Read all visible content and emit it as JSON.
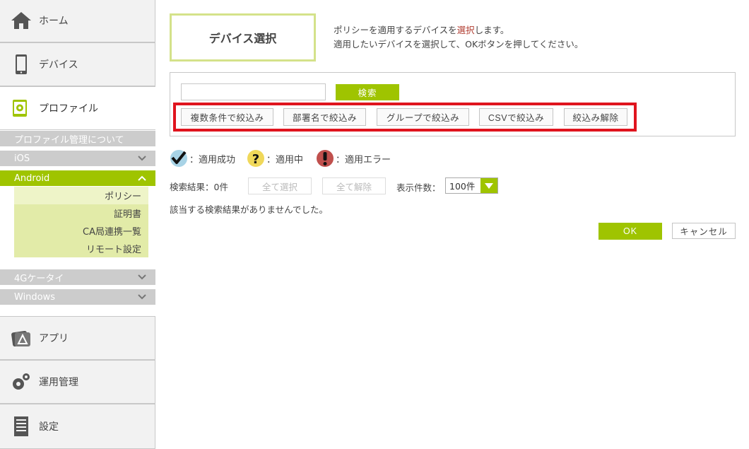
{
  "sidebar": {
    "home": "ホーム",
    "devices": "デバイス",
    "profiles": "プロファイル",
    "profile_about": "プロファイル管理について",
    "ios": "iOS",
    "android": "Android",
    "android_items": [
      "ポリシー",
      "証明書",
      "CA局連携一覧",
      "リモート設定"
    ],
    "g4": "4Gケータイ",
    "windows": "Windows",
    "apps": "アプリ",
    "operations": "運用管理",
    "settings": "設定"
  },
  "main": {
    "title": "デバイス選択",
    "desc_line1_pre": "ポリシーを適用するデバイスを",
    "desc_line1_hl": "選択",
    "desc_line1_post": "します。",
    "desc_line2": "適用したいデバイスを選択して、OKボタンを押してください。",
    "search_value": "",
    "search_button": "検索",
    "filters": [
      "複数条件で絞込み",
      "部署名で絞込み",
      "グループで絞込み",
      "CSVで絞込み",
      "絞込み解除"
    ],
    "legend": [
      {
        "label": "：適用成功",
        "color": "#a8d3e6"
      },
      {
        "label": "：適用中",
        "color": "#f0d85a"
      },
      {
        "label": "：適用エラー",
        "color": "#c0504d"
      }
    ],
    "result_count": "検索結果：0件",
    "select_all": "全て選択",
    "deselect_all": "全て解除",
    "per_page_label": "表示件数：",
    "per_page_value": "100件",
    "no_result": "該当する検索結果がありませんでした。",
    "ok": "OK",
    "cancel": "キャンセル"
  },
  "colors": {
    "accent": "#9fc400",
    "highlight_frame": "#e0141e",
    "title_border": "#d4e28a"
  }
}
